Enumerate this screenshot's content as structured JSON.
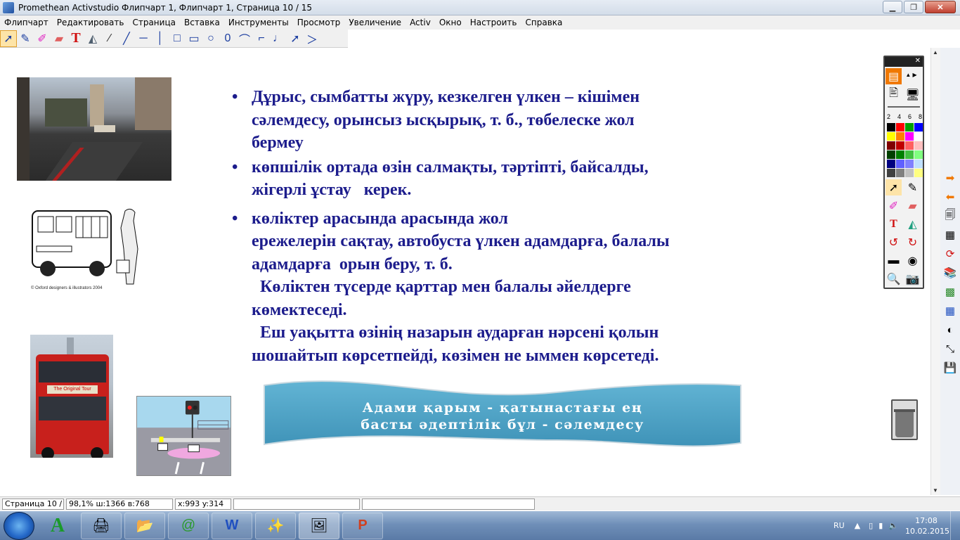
{
  "window": {
    "title": "Promethean Activstudio  Флипчарт 1,  Флипчарт 1,  Страница 10 / 15",
    "minimize": "▁",
    "maximize": "❐",
    "close": "✕"
  },
  "menu": [
    "Флипчарт",
    "Редактировать",
    "Страница",
    "Вставка",
    "Инструменты",
    "Просмотр",
    "Увеличение",
    "Activ",
    "Окно",
    "Настроить",
    "Справка"
  ],
  "slide": {
    "bullets": [
      {
        "lines": [
          "Дұрыс, сымбатты жүру, кезкелген үлкен – кішімен",
          "сәлемдесу, орынсыз ысқырық, т. б., төбелеске жол",
          "бермеу"
        ]
      },
      {
        "lines": [
          "көпшілік ортада өзін салмақты, тәртіпті, байсалды,",
          "жігерлі ұстау   керек."
        ]
      },
      {
        "lines": [
          "көліктер арасында арасында жол",
          "ережелерін сақтау, автобуста үлкен адамдарға, балалы",
          "адамдарға  орын беру, т. б.",
          "  Көліктен түсерде қарттар мен балалы әйелдерге",
          "көмектеседі.",
          "  Еш уақытта өзінің назарын аударған нәрсені қолын",
          "шошайтып көрсетпейді, көзімен не ыммен көрсетеді."
        ]
      }
    ],
    "banner_lines": [
      "Адами қарым - қатынастағы ең",
      "басты әдептілік бұл - сәлемдесу"
    ],
    "drawing_caption": "© Oxford designers & illustrators 2004",
    "bus_sign": "The Original Tour"
  },
  "toolbox": {
    "pen_sizes": [
      "2",
      "4",
      "6",
      "8"
    ],
    "palette": [
      "#000000",
      "#ff0000",
      "#00a000",
      "#0000ff",
      "#ffff00",
      "#ff8000",
      "#ff00ff",
      "#ffffff",
      "#800000",
      "#c00000",
      "#ff6060",
      "#ffc0c0",
      "#004000",
      "#008000",
      "#40c040",
      "#80ff80",
      "#000080",
      "#6060ff",
      "#8080ff",
      "#c0e0ff",
      "#404040",
      "#808080",
      "#c0c0c0",
      "#ffff80"
    ]
  },
  "status": {
    "page": "Страница 10 /",
    "zoom": "98,1%  ш:1366  в:768",
    "coords": "x:993  y:314"
  },
  "tray": {
    "lang": "RU",
    "time": "17:08",
    "date": "10.02.2015"
  }
}
